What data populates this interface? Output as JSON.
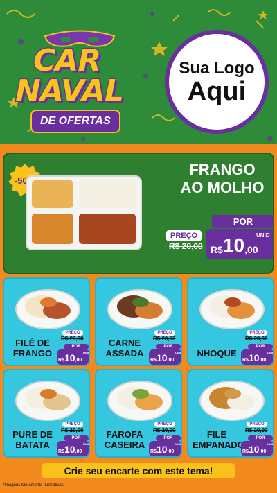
{
  "brand": {
    "line1": "CAR",
    "line2": "NAVAL",
    "tag": "DE OFERTAS"
  },
  "logo": {
    "line1": "Sua Logo",
    "line2": "Aqui"
  },
  "featured": {
    "discount": "-50%",
    "title_line1": "FRANGO",
    "title_line2": "AO MOLHO",
    "preco_label": "PREÇO",
    "old_price": "R$ 20,00",
    "por_label": "POR",
    "currency": "R$ ",
    "new_int": "10",
    "new_dec": ",00",
    "unit": "UNID"
  },
  "items": [
    {
      "name": "FILÉ DE FRANGO",
      "preco_label": "PREÇO",
      "old_price": "R$ 20,00",
      "por_label": "POR",
      "currency": "R$ ",
      "new_int": "10",
      "new_dec": ",00",
      "unit": "UNID"
    },
    {
      "name": "CARNE ASSADA",
      "preco_label": "PREÇO",
      "old_price": "R$ 20,00",
      "por_label": "POR",
      "currency": "R$ ",
      "new_int": "10",
      "new_dec": ",00",
      "unit": "UNID"
    },
    {
      "name": "NHOQUE",
      "preco_label": "PREÇO",
      "old_price": "R$ 20,00",
      "por_label": "POR",
      "currency": "R$ ",
      "new_int": "10",
      "new_dec": ",00",
      "unit": "UNID"
    },
    {
      "name": "PURE DE BATATA",
      "preco_label": "PREÇO",
      "old_price": "R$ 20,00",
      "por_label": "POR",
      "currency": "R$ ",
      "new_int": "10",
      "new_dec": ",00",
      "unit": "UNID"
    },
    {
      "name": "FAROFA CASEIRA",
      "preco_label": "PREÇO",
      "old_price": "R$ 20,00",
      "por_label": "POR",
      "currency": "R$ ",
      "new_int": "10",
      "new_dec": ",00",
      "unit": "UNID"
    },
    {
      "name": "FILE EMPANADO",
      "preco_label": "PREÇO",
      "old_price": "R$ 20,00",
      "por_label": "POR",
      "currency": "R$ ",
      "new_int": "10",
      "new_dec": ",00",
      "unit": "UNID"
    }
  ],
  "footer": {
    "cta": "Crie seu encarte com este tema!",
    "disclaimer": "*Imagens Meramente Ilustrativas"
  },
  "colors": {
    "header_bg": "#2e8b3a",
    "purple": "#6a2f9e",
    "yellow": "#f9c31b",
    "orange": "#f28a1e",
    "card_bg": "#35c6e0"
  }
}
